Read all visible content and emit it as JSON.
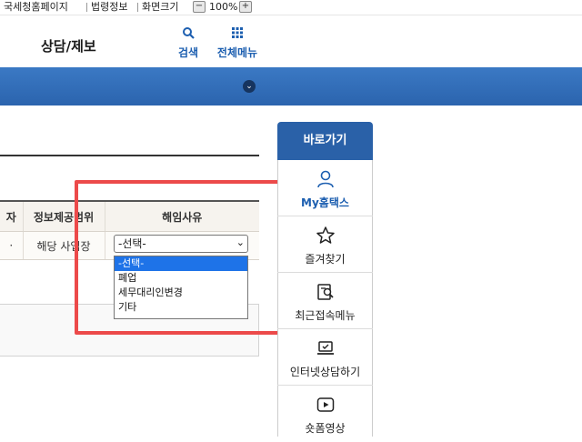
{
  "topbar": {
    "links": [
      "국세청홈페이지",
      "법령정보",
      "화면크기"
    ],
    "zoom_out": "−",
    "zoom_value": "100%",
    "zoom_in": "+"
  },
  "header": {
    "title": "상담/제보",
    "search_label": "검색",
    "all_menu_label": "전체메뉴"
  },
  "band": {
    "toggle_icon": "chevron-down-icon",
    "toggle_glyph": "⌄"
  },
  "table": {
    "headers": [
      "자",
      "정보제공범위",
      "해임사유"
    ],
    "row": [
      "·",
      "해당 사업장"
    ]
  },
  "select": {
    "value": "-선택-",
    "options": [
      "-선택-",
      "폐업",
      "세무대리인변경",
      "기타"
    ],
    "selected_index": 0
  },
  "quick_menu": {
    "title": "바로가기",
    "items": [
      {
        "label": "My홈택스",
        "icon": "person-icon",
        "active": true
      },
      {
        "label": "즐겨찾기",
        "icon": "star-icon",
        "active": false
      },
      {
        "label": "최근접속메뉴",
        "icon": "recent-search-icon",
        "active": false
      },
      {
        "label": "인터넷상담하기",
        "icon": "laptop-chat-icon",
        "active": false
      },
      {
        "label": "숏폼영상",
        "icon": "play-icon",
        "active": false
      }
    ]
  },
  "colors": {
    "primary": "#2a61a8",
    "highlight": "#ec4a4a",
    "selected_option": "#1e73e8"
  }
}
